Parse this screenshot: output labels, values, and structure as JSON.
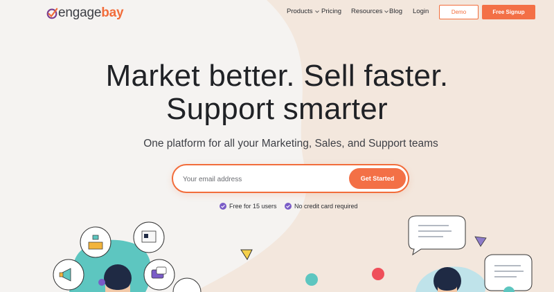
{
  "brand": {
    "name_part1": "engage",
    "name_part2": "bay",
    "accent": "#f26c3a"
  },
  "nav": {
    "items": [
      {
        "label": "Products",
        "dropdown": true
      },
      {
        "label": "Pricing",
        "dropdown": false
      },
      {
        "label": "Resources",
        "dropdown": true
      },
      {
        "label": "Blog",
        "dropdown": false
      },
      {
        "label": "Login",
        "dropdown": false
      }
    ],
    "demo_label": "Demo",
    "signup_label": "Free Signup"
  },
  "hero": {
    "headline_line1": "Market better. Sell faster.",
    "headline_line2": "Support smarter",
    "subhead": "One platform for all your Marketing, Sales, and Support teams",
    "email_placeholder": "Your email address",
    "cta_label": "Get Started",
    "perks": [
      {
        "label": "Free for 15 users",
        "icon": "check-circle-icon"
      },
      {
        "label": "No credit card required",
        "icon": "check-circle-icon"
      }
    ]
  },
  "colors": {
    "cta": "#f37046",
    "check": "#7a5cc7",
    "teal": "#5dc6c0",
    "beige": "#f3e6dc"
  }
}
